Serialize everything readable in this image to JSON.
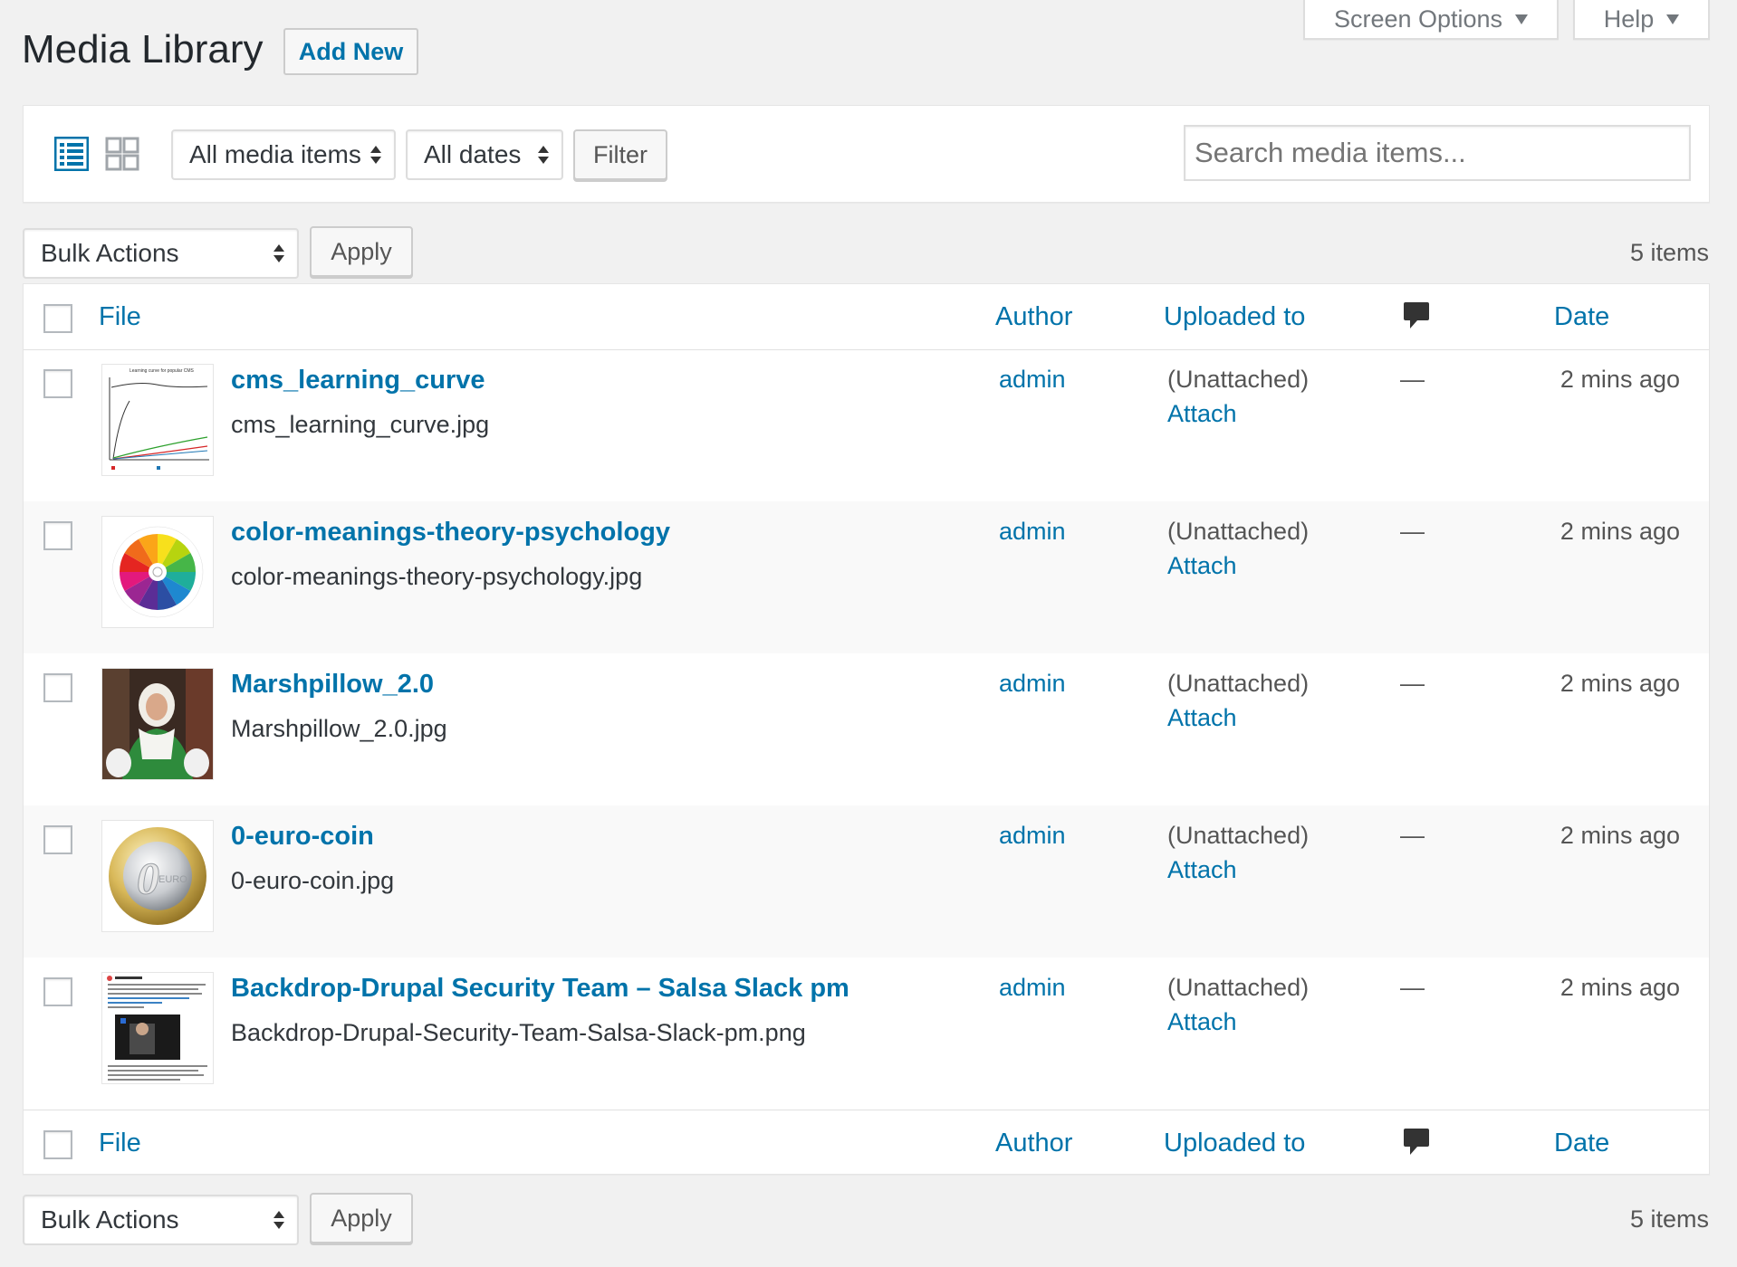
{
  "header": {
    "title": "Media Library",
    "add_new": "Add New",
    "screen_options": "Screen Options",
    "help": "Help"
  },
  "filters": {
    "type_select": "All media items",
    "date_select": "All dates",
    "filter_button": "Filter",
    "search_placeholder": "Search media items..."
  },
  "bulk": {
    "select": "Bulk Actions",
    "apply": "Apply",
    "count": "5 items"
  },
  "columns": {
    "file": "File",
    "author": "Author",
    "uploaded_to": "Uploaded to",
    "date": "Date"
  },
  "rows": [
    {
      "title": "cms_learning_curve",
      "filename": "cms_learning_curve.jpg",
      "author": "admin",
      "uploaded": "(Unattached)",
      "attach": "Attach",
      "comments": "—",
      "date": "2 mins ago",
      "thumb": "learning-curve-chart"
    },
    {
      "title": "color-meanings-theory-psychology",
      "filename": "color-meanings-theory-psychology.jpg",
      "author": "admin",
      "uploaded": "(Unattached)",
      "attach": "Attach",
      "comments": "—",
      "date": "2 mins ago",
      "thumb": "color-wheel"
    },
    {
      "title": "Marshpillow_2.0",
      "filename": "Marshpillow_2.0.jpg",
      "author": "admin",
      "uploaded": "(Unattached)",
      "attach": "Attach",
      "comments": "—",
      "date": "2 mins ago",
      "thumb": "person-photo"
    },
    {
      "title": "0-euro-coin",
      "filename": "0-euro-coin.jpg",
      "author": "admin",
      "uploaded": "(Unattached)",
      "attach": "Attach",
      "comments": "—",
      "date": "2 mins ago",
      "thumb": "euro-coin"
    },
    {
      "title": "Backdrop-Drupal Security Team – Salsa Slack pm",
      "filename": "Backdrop-Drupal-Security-Team-Salsa-Slack-pm.png",
      "author": "admin",
      "uploaded": "(Unattached)",
      "attach": "Attach",
      "comments": "—",
      "date": "2 mins ago",
      "thumb": "chat-screenshot"
    }
  ],
  "colors": {
    "link": "#0073aa",
    "background": "#f1f1f1",
    "text": "#23282d"
  }
}
